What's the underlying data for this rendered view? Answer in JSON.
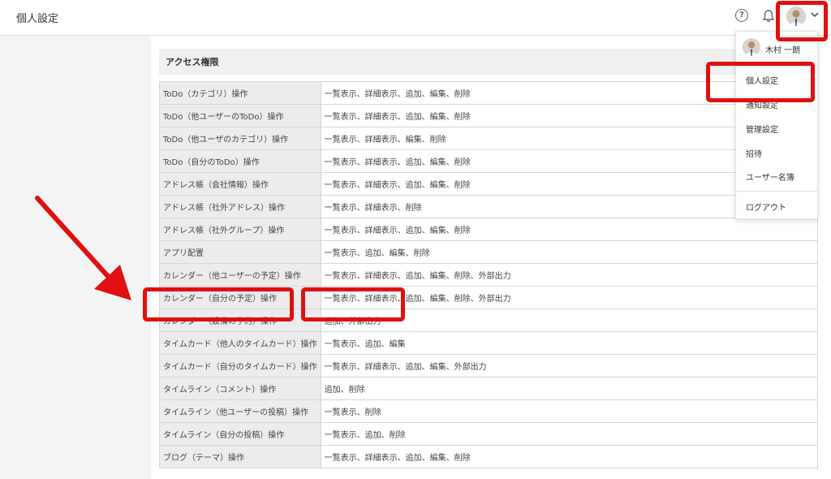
{
  "header": {
    "title": "個人設定"
  },
  "section": {
    "title": "アクセス権限"
  },
  "permissions": [
    {
      "key": "ToDo（カテゴリ）操作",
      "value": "一覧表示、詳細表示、追加、編集、削除"
    },
    {
      "key": "ToDo（他ユーザーのToDo）操作",
      "value": "一覧表示、詳細表示、追加、編集、削除"
    },
    {
      "key": "ToDo（他ユーザのカテゴリ）操作",
      "value": "一覧表示、詳細表示、編集、削除"
    },
    {
      "key": "ToDo（自分のToDo）操作",
      "value": "一覧表示、詳細表示、追加、編集、削除"
    },
    {
      "key": "アドレス帳（会社情報）操作",
      "value": "一覧表示、詳細表示、追加、編集、削除"
    },
    {
      "key": "アドレス帳（社外アドレス）操作",
      "value": "一覧表示、詳細表示、削除"
    },
    {
      "key": "アドレス帳（社外グループ）操作",
      "value": "一覧表示、詳細表示、追加、編集、削除"
    },
    {
      "key": "アプリ配置",
      "value": "一覧表示、追加、編集、削除"
    },
    {
      "key": "カレンダー（他ユーザーの予定）操作",
      "value": "一覧表示、詳細表示、追加、編集、削除、外部出力"
    },
    {
      "key": "カレンダー（自分の予定）操作",
      "value": "一覧表示、詳細表示、追加、編集、削除、外部出力"
    },
    {
      "key": "カレンダー（設備の予約）操作",
      "value": "追加、外部出力"
    },
    {
      "key": "タイムカード（他人のタイムカード）操作",
      "value": "一覧表示、追加、編集"
    },
    {
      "key": "タイムカード（自分のタイムカード）操作",
      "value": "一覧表示、詳細表示、追加、編集、外部出力"
    },
    {
      "key": "タイムライン（コメント）操作",
      "value": "追加、削除"
    },
    {
      "key": "タイムライン（他ユーザーの投稿）操作",
      "value": "一覧表示、削除"
    },
    {
      "key": "タイムライン（自分の投稿）操作",
      "value": "一覧表示、追加、削除"
    },
    {
      "key": "ブログ（テーマ）操作",
      "value": "一覧表示、詳細表示、追加、編集、削除"
    }
  ],
  "user_menu": {
    "user_name": "木村 一朗",
    "items": [
      "個人設定",
      "通知設定",
      "管理設定",
      "招待",
      "ユーザー名簿"
    ],
    "logout": "ログアウト"
  },
  "icons": [
    "help-icon",
    "bell-icon",
    "avatar",
    "chevron-down-icon"
  ],
  "colors": {
    "highlight": "#e01010",
    "header_bg": "#ffffff",
    "key_cell_bg": "#ececec"
  }
}
